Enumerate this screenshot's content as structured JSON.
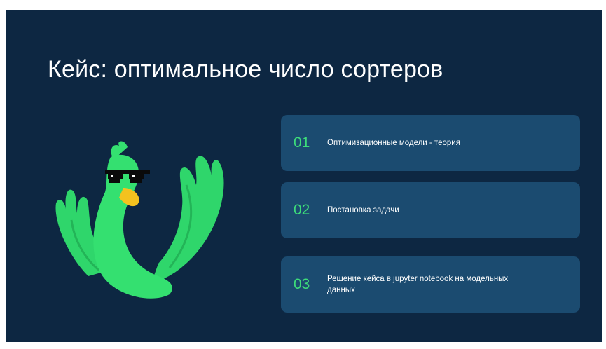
{
  "slide": {
    "title": "Кейс: оптимальное число сортеров",
    "background_color": "#0d2742",
    "accent_color": "#3ddc7a",
    "card_color": "#1b4b70",
    "illustration": "green-bird-with-sunglasses-icon"
  },
  "agenda": [
    {
      "number": "01",
      "text": "Оптимизационные модели - теория"
    },
    {
      "number": "02",
      "text": "Постановка задачи"
    },
    {
      "number": "03",
      "text": "Решение кейса в jupyter notebook на модельных данных"
    }
  ]
}
